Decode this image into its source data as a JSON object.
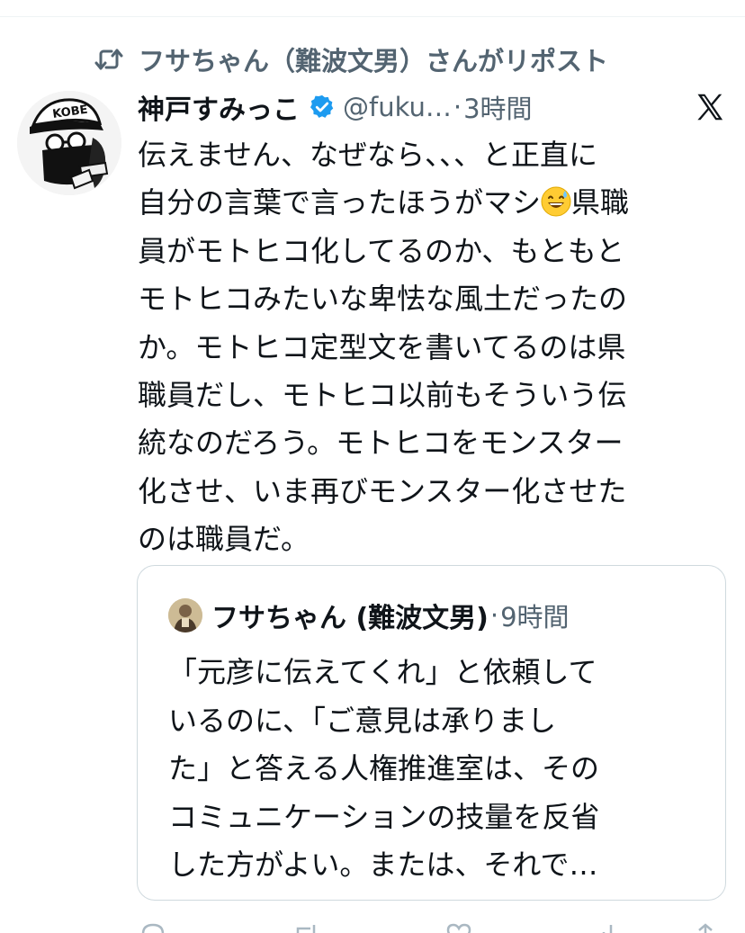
{
  "repost": {
    "icon": "repost-icon",
    "text": "フサちゃん（難波文男）さんがリポスト"
  },
  "post": {
    "author": {
      "display_name": "神戸すみっこ",
      "handle": "@fuku…",
      "verified": true,
      "verified_color": "#1d9bf0",
      "avatar_text": "KOBE"
    },
    "separator": "·",
    "time": "3時間",
    "platform_icon": "x-logo-icon",
    "text_lines": [
      "伝えません、なぜなら、、、と正直に",
      "自分の言葉で言ったほうがマシ",
      "員がモトヒコ化してるのか、もともと",
      "モトヒコみたいな卑怯な風土だったの",
      "か。モトヒコ定型文を書いてるのは県",
      "職員だし、モトヒコ以前もそういう伝",
      "統なのだろう。モトヒコをモンスター",
      "化させ、いま再びモンスター化させた",
      "のは職員だ。"
    ],
    "line2_after_emoji": "県職",
    "emoji": "grinning-face-with-sweat-emoji"
  },
  "quote": {
    "author": {
      "display_name": "フサちゃん (難波文男)"
    },
    "separator": "·",
    "time": "9時間",
    "text_lines": [
      "「元彦に伝えてくれ」と依頼して",
      "いるのに、「ご意見は承りまし",
      "た」と答える人権推進室は、その",
      "コミュニケーションの技量を反省",
      "した方がよい。または、それで…"
    ]
  },
  "colors": {
    "text_primary": "#0f1419",
    "text_secondary": "#536471",
    "border": "#cfd9de",
    "verified": "#1d9bf0"
  }
}
